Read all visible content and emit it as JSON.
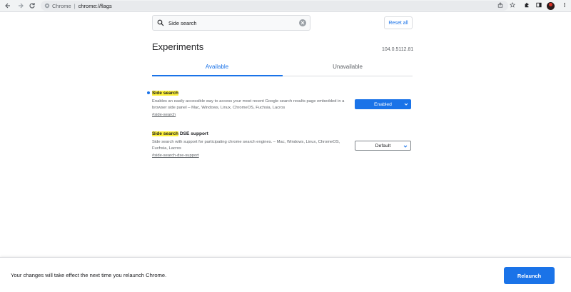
{
  "browser": {
    "chip_label": "Chrome",
    "url": "chrome://flags"
  },
  "search": {
    "value": "Side search"
  },
  "header": {
    "reset_label": "Reset all",
    "title": "Experiments",
    "version": "104.0.5112.81"
  },
  "tabs": [
    {
      "label": "Available",
      "active": true
    },
    {
      "label": "Unavailable",
      "active": false
    }
  ],
  "experiments": [
    {
      "name_highlight": "Side search",
      "name_rest": "",
      "description": "Enables an easily accessible way to access your most recent Google search results page embedded in a browser side panel – Mac, Windows, Linux, ChromeOS, Fuchsia, Lacros",
      "link": "#side-search",
      "select_value": "Enabled"
    },
    {
      "name_highlight": "Side search",
      "name_rest": " DSE support",
      "description": "Side search with support for participating chrome search engines. – Mac, Windows, Linux, ChromeOS, Fuchsia, Lacros",
      "link": "#side-search-dse-support",
      "select_value": "Default"
    }
  ],
  "bottom": {
    "message": "Your changes will take effect the next time you relaunch Chrome.",
    "relaunch_label": "Relaunch"
  },
  "colors": {
    "accent": "#1a73e8",
    "highlight": "#fff23a"
  }
}
